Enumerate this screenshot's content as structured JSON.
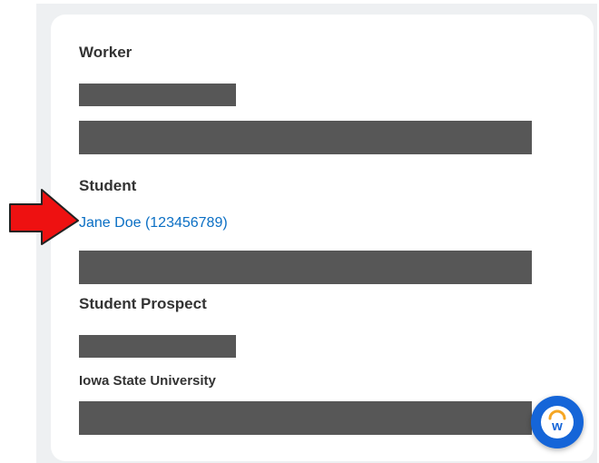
{
  "sections": {
    "worker": {
      "heading": "Worker"
    },
    "student": {
      "heading": "Student",
      "link_text": "Jane Doe (123456789)"
    },
    "student_prospect": {
      "heading": "Student Prospect"
    },
    "university": {
      "heading": "Iowa State University"
    }
  },
  "fab": {
    "icon": "workday-logo-icon",
    "letter": "w"
  },
  "annotation": {
    "icon": "red-arrow-icon",
    "color": "#ee1111"
  },
  "colors": {
    "link": "#0b6fc4",
    "redaction": "#575757",
    "fab": "#1565d8",
    "card_bg": "#ffffff",
    "page_bg": "#eef0f2"
  }
}
